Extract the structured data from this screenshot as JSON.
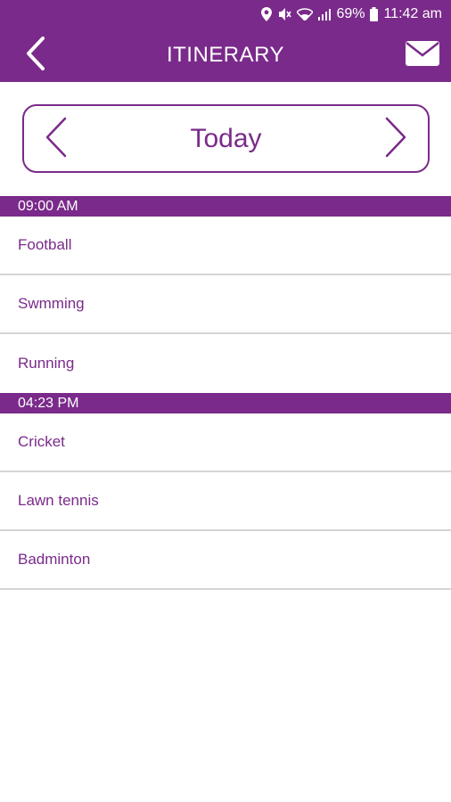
{
  "status_bar": {
    "battery": "69%",
    "time": "11:42 am",
    "icons": [
      "location-icon",
      "mute-icon",
      "wifi-icon",
      "signal-icon",
      "battery-icon"
    ]
  },
  "app_bar": {
    "title": "ITINERARY",
    "back_icon": "back-chevron-icon",
    "mail_icon": "mail-icon"
  },
  "date_nav": {
    "label": "Today",
    "prev_icon": "chevron-left-icon",
    "next_icon": "chevron-right-icon"
  },
  "schedule": [
    {
      "time": "09:00 AM",
      "items": [
        "Football",
        "Swmming",
        "Running"
      ]
    },
    {
      "time": "04:23 PM",
      "items": [
        "Cricket",
        "Lawn tennis",
        "Badminton"
      ]
    }
  ],
  "colors": {
    "accent": "#7a2a8a",
    "divider": "#d5d5d5",
    "background": "#ffffff"
  }
}
